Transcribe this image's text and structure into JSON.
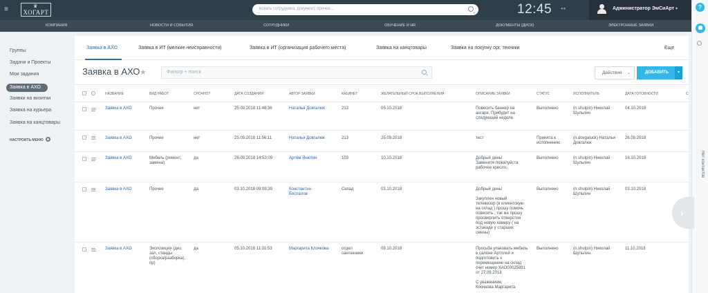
{
  "header": {
    "logo_text": "ХОГАРТ",
    "search_placeholder": "искать сотрудника, документ, прочее...",
    "clock": "12:45",
    "user_name": "Администратор ЭмСиАрт"
  },
  "mainnav": [
    "КОМПАНИЯ",
    "НОВОСТИ И СОБЫТИЯ",
    "СОТРУДНИКИ",
    "ОБУЧЕНИЕ И HR",
    "ДОКУМЕНТЫ (ДИСК)",
    "ЭЛЕКТРОННЫЕ ЗАЯВКИ"
  ],
  "leftmenu": {
    "items": [
      "Группы",
      "Задачи и Проекты",
      "Мои задания",
      "Заявка в АХО",
      "Заявки на визитки",
      "Заявка на курьера",
      "Заявка на канцтовары"
    ],
    "settings": "НАСТРОИТЬ МЕНЮ"
  },
  "tabs": [
    "Заявка в АХО",
    "Заявка в ИТ (мелкие неисправности)",
    "Заявка в ИТ (организация рабочего места)",
    "Заявка на канцтовары",
    "Заявка на покупку орг. техники",
    "Еще"
  ],
  "page": {
    "title": "Заявка в АХО",
    "filter_placeholder": "Фильтр + поиск",
    "actions_label": "Действия",
    "add_label": "ДОБАВИТЬ"
  },
  "table": {
    "columns": [
      "НАЗВАНИЕ",
      "ВИД РАБОТ",
      "СРОЧНО?",
      "ДАТА СОЗДАНИЯ",
      "АВТОР ЗАЯВКИ",
      "КАБИНЕТ",
      "ЖЕЛАТЕЛЬНЫЙ СРОК ВЫПОЛНЕНИЯ",
      "ОПИСАНИЕ ЗАЯВКИ",
      "СТАТУС",
      "ИСПОЛНИТЕЛЬ",
      "ДАТА ГОТОВНОСТИ",
      "С"
    ],
    "rows": [
      {
        "name": "Заявка в АХО",
        "work": "Прочее",
        "urgent": "нет",
        "created": "25.09.2018 11:48:36",
        "author": "Наталья Довгалюк",
        "room": "213",
        "due": "05.10.2018",
        "description": "Повесить баннер на ангаре. Прибудет на следующей неделе.",
        "status": "Выполнено",
        "executor": "(n.shulpin) Николай Шульпин",
        "ready": "04.10.2018"
      },
      {
        "name": "Заявка в АХО",
        "work": "Прочее",
        "urgent": "нет",
        "created": "25.09.2018 11:56:11",
        "author": "Наталья Довгалюк",
        "room": "213",
        "due": "25.09.2018",
        "description": "тест",
        "status": "Принята к исполнению",
        "executor": "(n.dovgaluck) Наталья Довгалюк",
        "ready": "26.09.2018"
      },
      {
        "name": "Заявка в АХО",
        "work": "Мебель (ремонт, замена)",
        "urgent": "да",
        "created": "26.09.2018 14:53:09",
        "author": "Артём Янютин",
        "room": "103",
        "due": "10.10.2018",
        "description": "Добрый день! Замените пожалуйста рабочее кресло.",
        "status": "Выполнено",
        "executor": "(n.shulpin) Николай Шульпин",
        "ready": "16.10.2018"
      },
      {
        "name": "Заявка в АХО",
        "work": "Прочее",
        "urgent": "да",
        "created": "03.10.2018 09:09:39",
        "author": "Константин Беспалов",
        "room": "Склад",
        "due": "03.10.2018",
        "description": "Добрый день!\n\nЗакуплен новый телевизор (в клиентскую на склад ) прошу помочь повесить , так же прошу просверлить отверстия под новую камеру ( на эстакаде у старших смены)",
        "status": "Выполнено",
        "executor": "(n.shulpin) Николай Шульпин",
        "ready": "03.10.2018"
      },
      {
        "name": "Заявка в АХО",
        "work": "Экспозиция (диз. зал, стенды (сборка/разборка), пр)",
        "urgent": "да",
        "created": "05.10.2018 11:31:53",
        "author": "Маргарита Клочкова",
        "room": "отдел сантехники",
        "due": "09.10.2018",
        "description": "Просьба упаковать мебель в салоне Артплей и подготовить к перемещению на склад счет номер ХАО00025891 от 27.09.2018\n\nС уважением,\nКлочкова Маргарита",
        "status": "Выполнено",
        "executor": "(n.shulpin) Николай Шульпин",
        "ready": "11.10.2018"
      }
    ]
  },
  "rightbar": {
    "help": "?",
    "no_contacts": "Нет контактов"
  },
  "colors": {
    "accent": "#2fb8e8",
    "header": "#2f3f4a",
    "nav": "#3e4a53",
    "link": "#2a67a8"
  }
}
